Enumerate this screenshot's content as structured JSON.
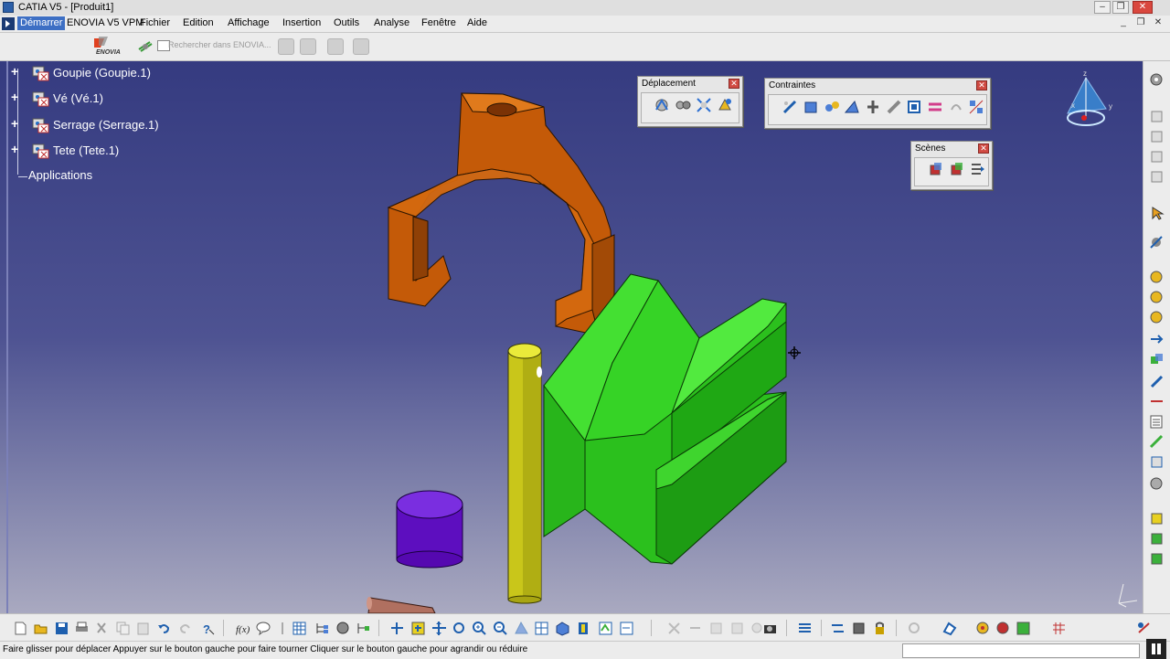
{
  "window": {
    "title": "CATIA V5 - [Produit1]"
  },
  "menu": {
    "items": [
      "Démarrer",
      "ENOVIA V5 VPM",
      "Fichier",
      "Edition",
      "Affichage",
      "Insertion",
      "Outils",
      "Analyse",
      "Fenêtre",
      "Aide"
    ]
  },
  "enovia_toolbar": {
    "logo_text": "ENOVIA",
    "search_placeholder": "Rechercher dans ENOVIA..."
  },
  "tree": {
    "items": [
      {
        "label": "Goupie (Goupie.1)"
      },
      {
        "label": "Vé (Vé.1)"
      },
      {
        "label": "Serrage (Serrage.1)"
      },
      {
        "label": "Tete (Tete.1)"
      }
    ],
    "applications_label": "Applications"
  },
  "panels": {
    "deplacement": {
      "title": "Déplacement"
    },
    "contraintes": {
      "title": "Contraintes"
    },
    "scenes": {
      "title": "Scènes"
    }
  },
  "compass": {
    "x": "x",
    "y": "y",
    "z": "z"
  },
  "status": {
    "message": "Faire glisser pour déplacer  Appuyer sur le bouton gauche pour faire tourner  Cliquer sur le bouton gauche pour agrandir ou réduire"
  },
  "colors": {
    "viewport_top": "#353b80",
    "viewport_bottom": "#a9a9c0",
    "part_orange": "#cc5f0a",
    "part_green": "#2fd11f",
    "part_yellow": "#d9d91a",
    "part_purple": "#6a10c8"
  }
}
